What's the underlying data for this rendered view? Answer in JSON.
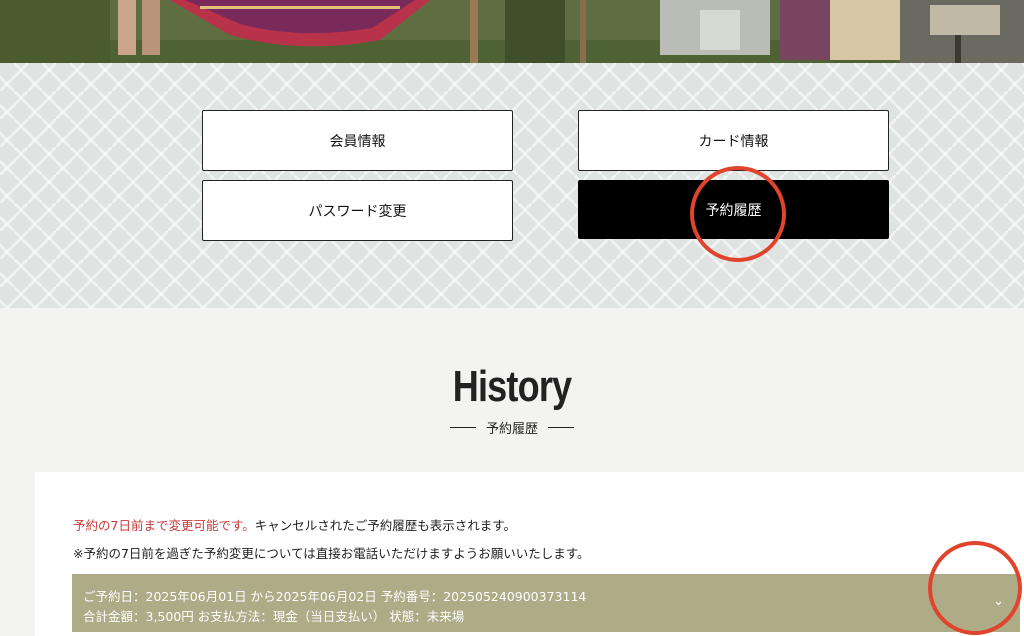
{
  "nav": {
    "member_info": "会員情報",
    "card_info": "カード情報",
    "password_change": "パスワード変更",
    "reservation_history": "予約履歴"
  },
  "heading": {
    "title": "History",
    "subtitle": "予約履歴"
  },
  "notice": {
    "red_text": "予約の7日前まで変更可能です。",
    "text1": "キャンセルされたご予約履歴も表示されます。",
    "text2": "※予約の7日前を過ぎた予約変更については直接お電話いただけますようお願いいたします。"
  },
  "reservation": {
    "line1": "ご予約日：2025年06月01日 から2025年06月02日 予約番号：202505240900373114",
    "line2": "合計金額：3,500円 お支払方法：現金（当日支払い） 状態：未来場",
    "expand_icon": "chevron-down-icon"
  },
  "colors": {
    "accent_red": "#c8393a",
    "highlight_ring": "#e0442c",
    "reservation_bar": "#aeab87",
    "active_button": "#000000"
  }
}
